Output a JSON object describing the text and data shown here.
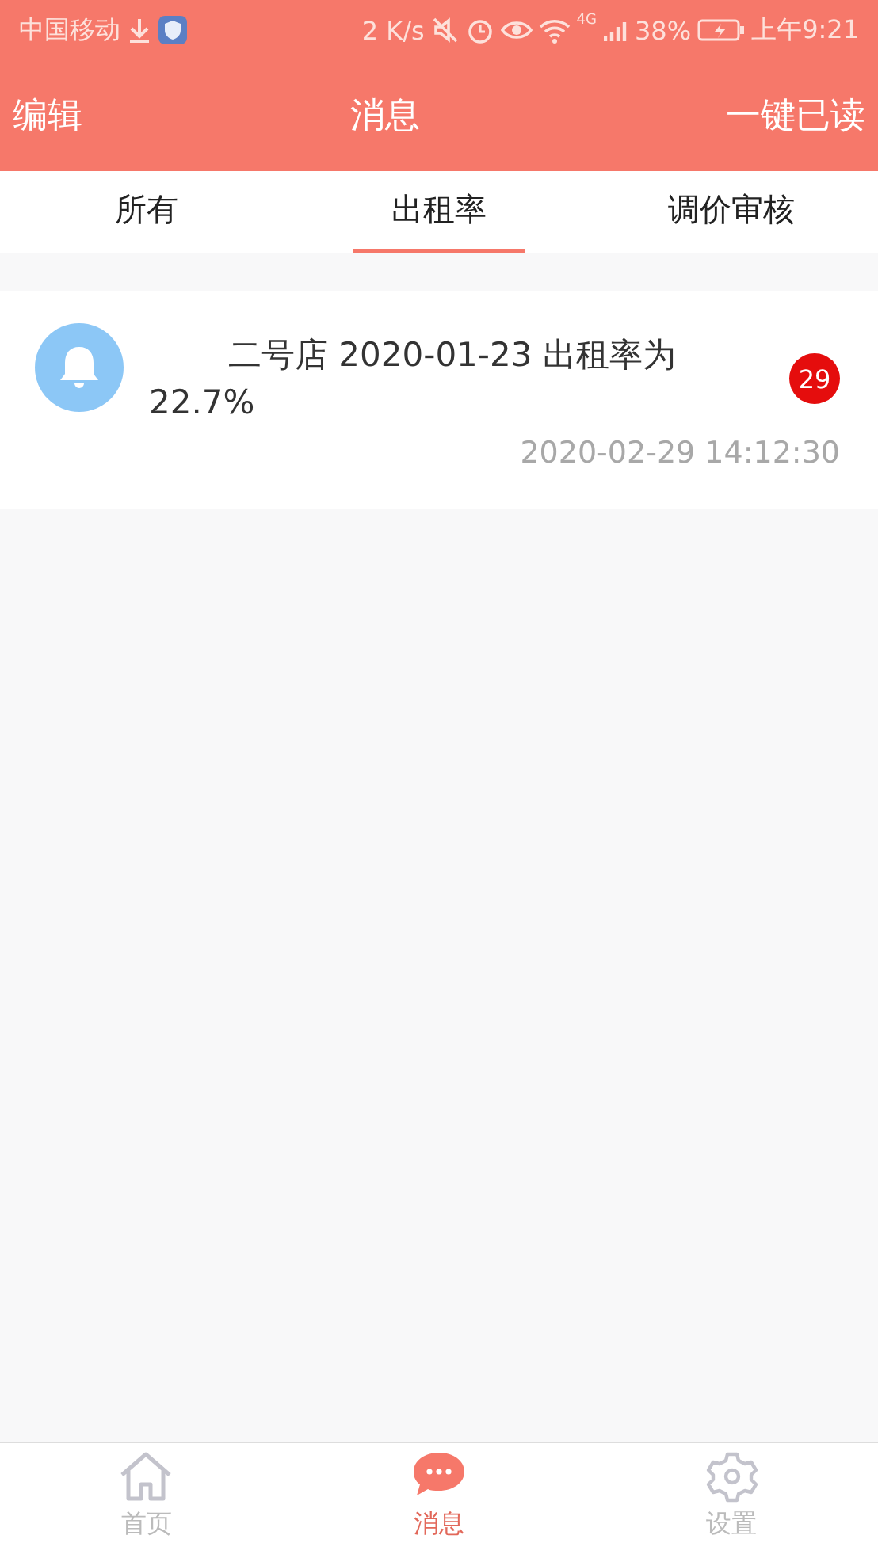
{
  "status_bar": {
    "carrier": "中国移动",
    "speed": "2 K/s",
    "network": "4G",
    "battery": "38%",
    "time": "上午9:21"
  },
  "header": {
    "left": "编辑",
    "title": "消息",
    "right": "一键已读"
  },
  "tabs": [
    {
      "label": "所有",
      "selected": false
    },
    {
      "label": "出租率",
      "selected": true
    },
    {
      "label": "调价审核",
      "selected": false
    }
  ],
  "messages": [
    {
      "text": "二号店 2020-01-23 出租率为 22.7%",
      "count": "29",
      "time": "2020-02-29 14:12:30"
    }
  ],
  "bottom_nav": [
    {
      "label": "首页",
      "kind": "home",
      "selected": false
    },
    {
      "label": "消息",
      "kind": "chat",
      "selected": true
    },
    {
      "label": "设置",
      "kind": "settings",
      "selected": false
    }
  ]
}
